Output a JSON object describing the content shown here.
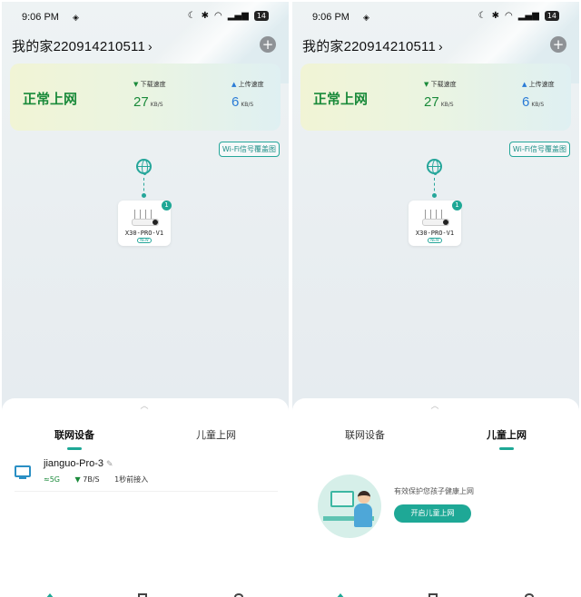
{
  "screens": [
    {
      "status_bar": {
        "time": "9:06 PM",
        "battery": "14"
      },
      "home_title": "我的家220914210511",
      "net_status": "正常上网",
      "download": {
        "label": "下载速度",
        "value": "27",
        "unit": "KB/S"
      },
      "upload": {
        "label": "上传速度",
        "value": "6",
        "unit": "KB/S"
      },
      "wifi_map_label": "Wi-Fi信号覆盖图",
      "router": {
        "name": "X30-PRO-V1",
        "badge": "1",
        "tag": "NEW"
      },
      "tabs": [
        {
          "label": "联网设备",
          "active": true
        },
        {
          "label": "儿童上网",
          "active": false
        }
      ],
      "device": {
        "name": "jianguo-Pro-3",
        "band": "5G",
        "speed": "7B/S",
        "time": "1秒前接入"
      }
    },
    {
      "status_bar": {
        "time": "9:06 PM",
        "battery": "14"
      },
      "home_title": "我的家220914210511",
      "net_status": "正常上网",
      "download": {
        "label": "下载速度",
        "value": "27",
        "unit": "KB/S"
      },
      "upload": {
        "label": "上传速度",
        "value": "6",
        "unit": "KB/S"
      },
      "wifi_map_label": "Wi-Fi信号覆盖图",
      "router": {
        "name": "X30-PRO-V1",
        "badge": "1",
        "tag": "NEW"
      },
      "tabs": [
        {
          "label": "联网设备",
          "active": false
        },
        {
          "label": "儿童上网",
          "active": true
        }
      ],
      "kids": {
        "text": "有效保护您孩子健康上网",
        "button": "开启儿童上网"
      }
    }
  ],
  "colors": {
    "accent": "#1ea896",
    "status_green": "#1a8a3a",
    "upload_blue": "#2a7bd6"
  }
}
